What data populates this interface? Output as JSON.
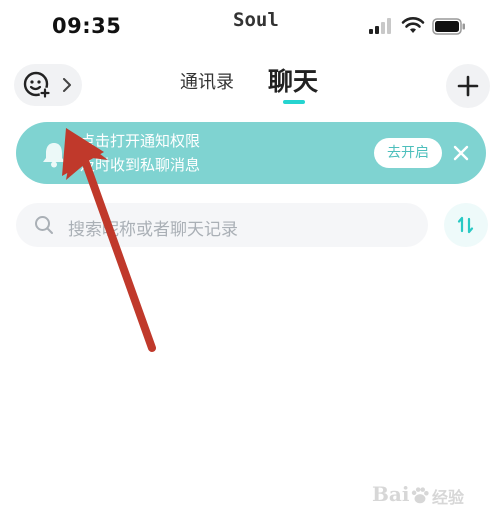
{
  "status_bar": {
    "time": "09:35",
    "carrier_app": "Soul",
    "icons": [
      "signal-icon",
      "wifi-icon",
      "battery-icon"
    ]
  },
  "header": {
    "mood_button_icon": "smiley-add-icon",
    "tabs": [
      {
        "label": "通讯录",
        "active": false
      },
      {
        "label": "聊天",
        "active": true
      }
    ],
    "add_icon": "plus-icon"
  },
  "notice": {
    "line1": "点击打开通知权限",
    "line2": "及时收到私聊消息",
    "enable_label": "去开启",
    "bell_icon": "bell-icon",
    "close_icon": "close-icon",
    "color": "#7fd3d1"
  },
  "search": {
    "placeholder": "搜索昵称或者聊天记录",
    "icon": "search-icon"
  },
  "sort_icon": "sort-icon",
  "colors": {
    "accent": "#25d4d0",
    "annotation_arrow": "#c0392b"
  },
  "watermark": {
    "text": "Bai",
    "suffix": "经验"
  }
}
